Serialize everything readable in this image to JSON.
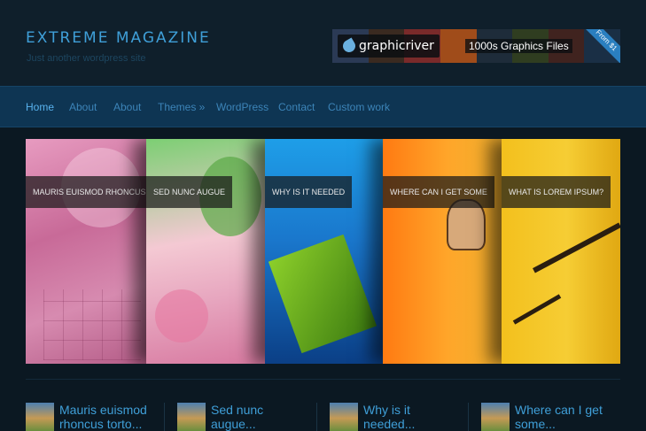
{
  "site": {
    "title": "EXTREME MAGAZINE",
    "tagline": "Just another wordpress site"
  },
  "banner": {
    "brand": "graphicriver",
    "tagline": "1000s Graphics Files",
    "ribbon": "From $1"
  },
  "nav": {
    "items": [
      {
        "label": "Home",
        "active": true
      },
      {
        "label": "About",
        "active": false
      },
      {
        "label": "About",
        "active": false
      },
      {
        "label": "Themes »",
        "active": false
      },
      {
        "label": "WordPress",
        "active": false
      },
      {
        "label": "Contact",
        "active": false
      },
      {
        "label": "Custom work",
        "active": false
      }
    ]
  },
  "slider": {
    "panels": [
      {
        "caption": "MAURIS EUISMOD RHONCUS TORTOR"
      },
      {
        "caption": "SED NUNC AUGUE"
      },
      {
        "caption": "WHY IS IT NEEDED"
      },
      {
        "caption": "WHERE CAN I GET SOME"
      },
      {
        "caption": "WHAT IS LOREM IPSUM?"
      }
    ]
  },
  "posts": [
    {
      "title": "Mauris euismod rhoncus torto..."
    },
    {
      "title": "Sed nunc augue..."
    },
    {
      "title": "Why is it needed..."
    },
    {
      "title": "Where can I get some..."
    }
  ],
  "colors": {
    "accent": "#3f9fd8",
    "nav_bg": "#0e3553",
    "page_bg": "#0b1822"
  }
}
